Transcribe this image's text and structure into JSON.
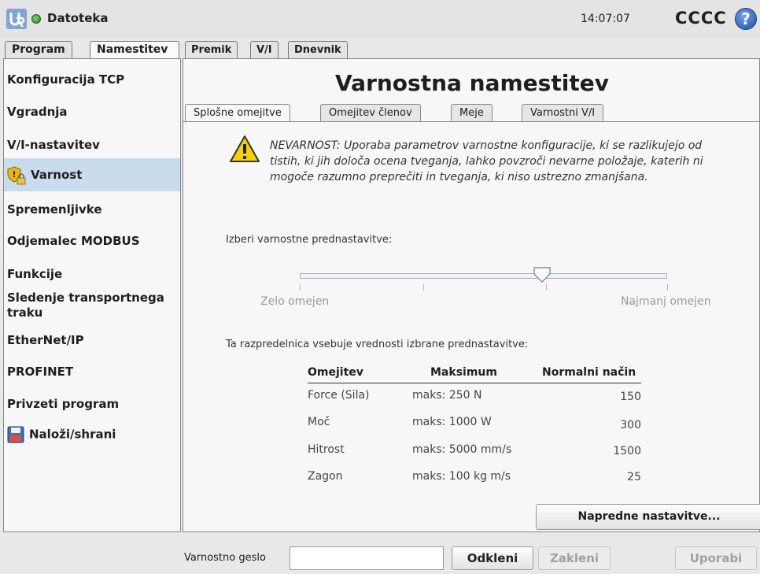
{
  "topbar": {
    "file_menu": "Datoteka",
    "clock": "14:07:07",
    "robot_name": "CCCC",
    "help": "?"
  },
  "main_tabs": [
    {
      "label": "Program",
      "active": false
    },
    {
      "label": "Namestitev",
      "active": true
    }
  ],
  "sub_tabs": [
    {
      "label": "Premik"
    },
    {
      "label": "V/I"
    },
    {
      "label": "Dnevnik"
    }
  ],
  "sidebar": {
    "items": [
      {
        "label": "Konfiguracija TCP"
      },
      {
        "label": "Vgradnja"
      },
      {
        "label": "V/I-nastavitev"
      },
      {
        "label": "Varnost",
        "active": true,
        "icon": "safety-shield-lock-icon"
      },
      {
        "label": "Spremenljivke"
      },
      {
        "label": "Odjemalec MODBUS"
      },
      {
        "label": "Funkcije"
      },
      {
        "label": "Sledenje transportnega traku"
      },
      {
        "label": "EtherNet/IP"
      },
      {
        "label": "PROFINET"
      },
      {
        "label": "Privzeti program"
      },
      {
        "label": "Naloži/shrani",
        "icon": "floppy-disk-icon"
      }
    ]
  },
  "main": {
    "title": "Varnostna namestitev",
    "inner_tabs": [
      {
        "label": "Splošne omejitve",
        "active": true
      },
      {
        "label": "Omejitev členov"
      },
      {
        "label": "Meje"
      },
      {
        "label": "Varnostni V/I"
      }
    ],
    "warning": "NEVARNOST: Uporaba parametrov varnostne konfiguracije, ki se razlikujejo od tistih, ki jih določa ocena tveganja, lahko povzroči nevarne položaje, katerih ni mogoče razumno preprečiti in tveganja, ki niso ustrezno zmanjšana.",
    "preset_label": "Izberi varnostne prednastavitve:",
    "slider": {
      "min_label": "Zelo omejen",
      "max_label": "Najmanj omejen",
      "value": 0.66
    },
    "table_caption": "Ta razpredelnica vsebuje vrednosti izbrane prednastavitve:",
    "table": {
      "headers": [
        "Omejitev",
        "Maksimum",
        "Normalni način"
      ],
      "rows": [
        [
          "Force (Sila)",
          "maks: 250 N",
          "150"
        ],
        [
          "Moč",
          "maks: 1000 W",
          "300"
        ],
        [
          "Hitrost",
          "maks: 5000 mm/s",
          "1500"
        ],
        [
          "Zagon",
          "maks: 100 kg m/s",
          "25"
        ]
      ]
    },
    "advanced_button": "Napredne nastavitve..."
  },
  "bottom": {
    "password_label": "Varnostno geslo",
    "password_value": "",
    "unlock": "Odkleni",
    "lock": "Zakleni",
    "apply": "Uporabi"
  }
}
